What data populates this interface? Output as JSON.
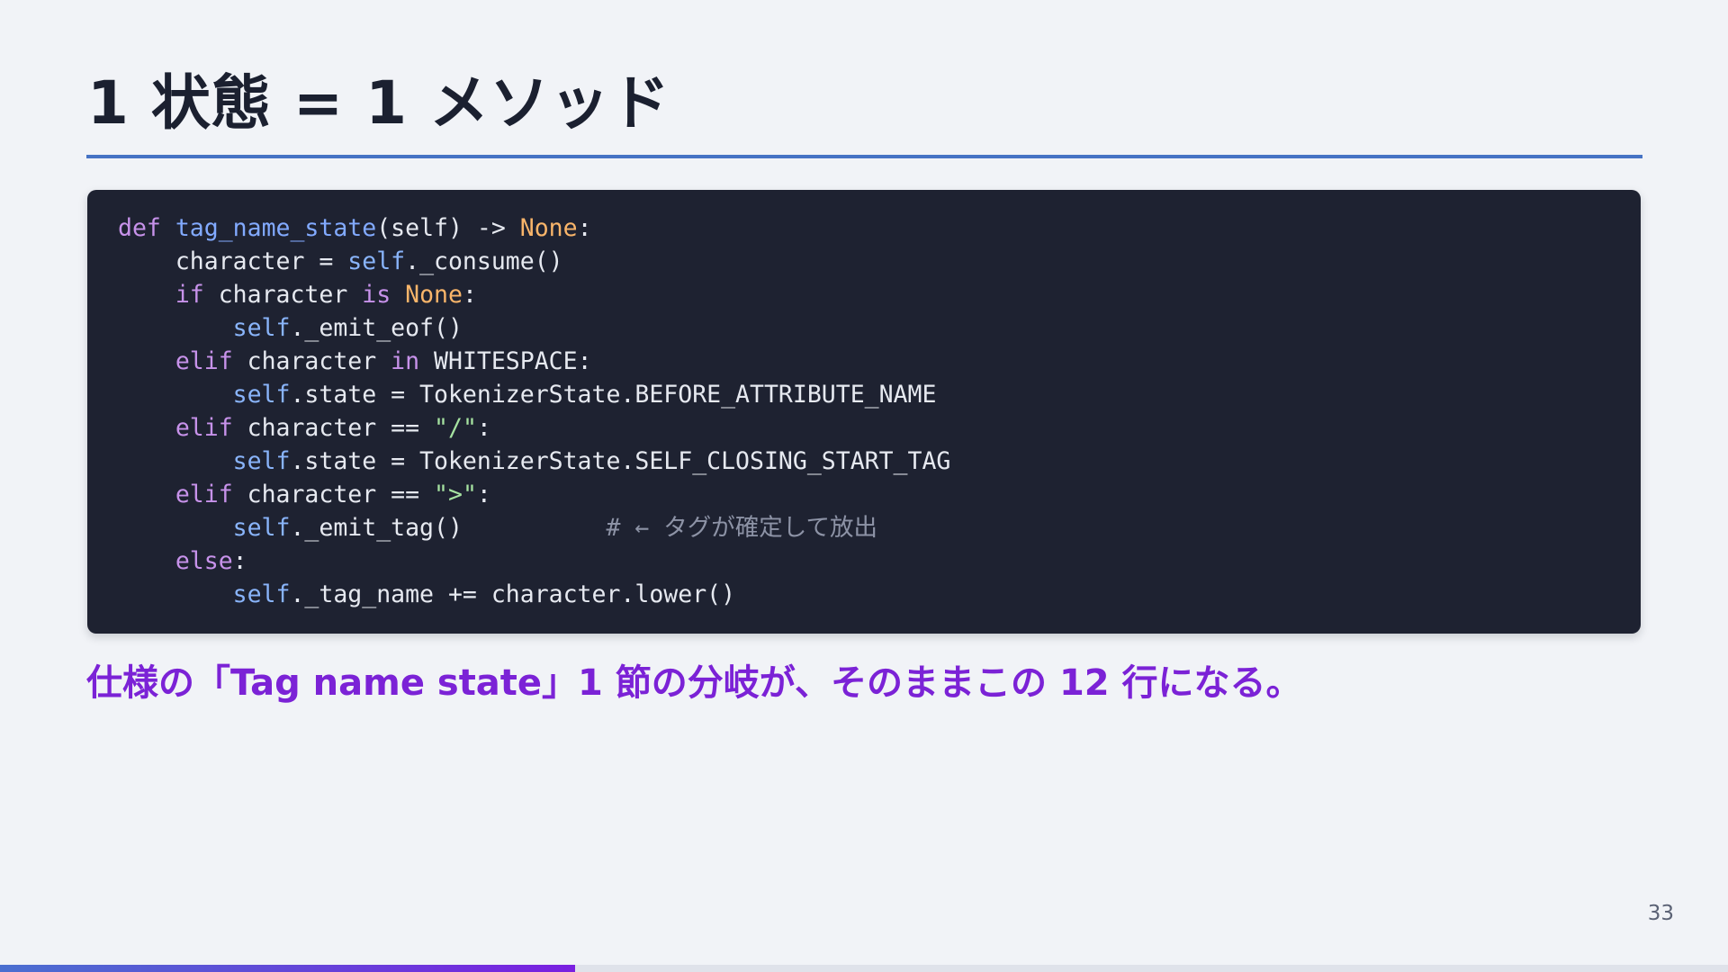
{
  "slide": {
    "title": "1 状態 = 1 メソッド",
    "caption": "仕様の「Tag name state」1 節の分岐が、そのままこの 12 行になる。",
    "page_number": "33",
    "progress": 0.333
  },
  "colors": {
    "title_rule": "#4673c4",
    "code_background": "#1e2231",
    "caption": "#7b22d6",
    "progress_start": "#4a6fd0",
    "progress_end": "#7a1fe0"
  },
  "code": {
    "language": "python",
    "lines": [
      [
        {
          "t": "def",
          "c": "kw"
        },
        {
          "t": " "
        },
        {
          "t": "tag_name_state",
          "c": "fn"
        },
        {
          "t": "(self) -> "
        },
        {
          "t": "None",
          "c": "const"
        },
        {
          "t": ":"
        }
      ],
      [
        {
          "t": "    character = "
        },
        {
          "t": "self",
          "c": "self"
        },
        {
          "t": "._consume()"
        }
      ],
      [
        {
          "t": "    "
        },
        {
          "t": "if",
          "c": "kw"
        },
        {
          "t": " character "
        },
        {
          "t": "is",
          "c": "kw"
        },
        {
          "t": " "
        },
        {
          "t": "None",
          "c": "const"
        },
        {
          "t": ":"
        }
      ],
      [
        {
          "t": "        "
        },
        {
          "t": "self",
          "c": "self"
        },
        {
          "t": "._emit_eof()"
        }
      ],
      [
        {
          "t": "    "
        },
        {
          "t": "elif",
          "c": "kw"
        },
        {
          "t": " character "
        },
        {
          "t": "in",
          "c": "kw"
        },
        {
          "t": " WHITESPACE:"
        }
      ],
      [
        {
          "t": "        "
        },
        {
          "t": "self",
          "c": "self"
        },
        {
          "t": ".state = TokenizerState.BEFORE_ATTRIBUTE_NAME"
        }
      ],
      [
        {
          "t": "    "
        },
        {
          "t": "elif",
          "c": "kw"
        },
        {
          "t": " character == "
        },
        {
          "t": "\"/\"",
          "c": "str"
        },
        {
          "t": ":"
        }
      ],
      [
        {
          "t": "        "
        },
        {
          "t": "self",
          "c": "self"
        },
        {
          "t": ".state = TokenizerState.SELF_CLOSING_START_TAG"
        }
      ],
      [
        {
          "t": "    "
        },
        {
          "t": "elif",
          "c": "kw"
        },
        {
          "t": " character == "
        },
        {
          "t": "\">\"",
          "c": "str"
        },
        {
          "t": ":"
        }
      ],
      [
        {
          "t": "        "
        },
        {
          "t": "self",
          "c": "self"
        },
        {
          "t": "._emit_tag()          "
        },
        {
          "t": "# ← タグが確定して放出",
          "c": "cm"
        }
      ],
      [
        {
          "t": "    "
        },
        {
          "t": "else",
          "c": "kw"
        },
        {
          "t": ":"
        }
      ],
      [
        {
          "t": "        "
        },
        {
          "t": "self",
          "c": "self"
        },
        {
          "t": "._tag_name += character.lower()"
        }
      ]
    ]
  }
}
